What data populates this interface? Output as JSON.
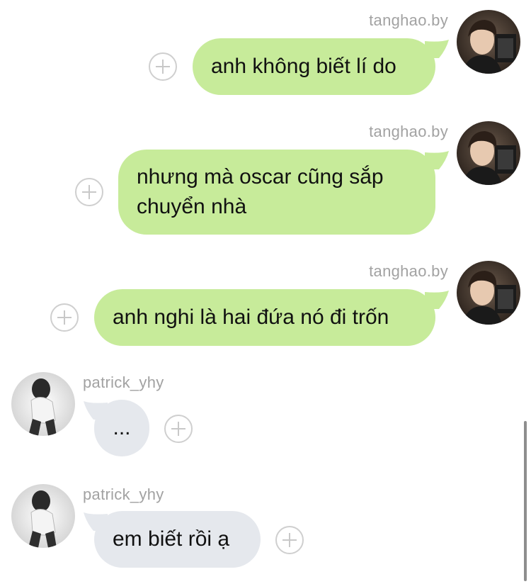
{
  "messages": [
    {
      "sender": "tanghao.by",
      "direction": "outgoing",
      "text": "anh không biết lí do"
    },
    {
      "sender": "tanghao.by",
      "direction": "outgoing",
      "text": "nhưng mà oscar cũng sắp chuyển nhà"
    },
    {
      "sender": "tanghao.by",
      "direction": "outgoing",
      "text": "anh nghi là hai đứa nó đi trốn"
    },
    {
      "sender": "patrick_yhy",
      "direction": "incoming",
      "text": "..."
    },
    {
      "sender": "patrick_yhy",
      "direction": "incoming",
      "text": "em biết rồi ạ"
    }
  ],
  "icons": {
    "add_reaction": "plus-circle-icon",
    "outgoing_avatar": "profile-photo-tanghao",
    "incoming_avatar": "profile-photo-patrick"
  },
  "colors": {
    "outgoing_bubble": "#c7eb9a",
    "incoming_bubble": "#e5e8ed",
    "sender_name": "#a2a2a2",
    "add_icon": "#cfcfcf"
  }
}
